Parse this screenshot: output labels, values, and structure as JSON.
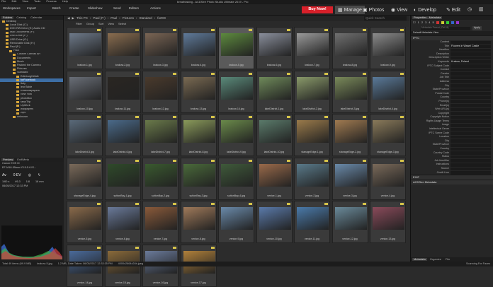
{
  "window": {
    "title": "breathtaking - ACDSee Photo Studio Ultimate 2019 - Pro"
  },
  "menu": [
    "File",
    "Edit",
    "View",
    "Tools",
    "Process",
    "Help"
  ],
  "toolbar": {
    "workspaces": "Workspaces",
    "import": "Import",
    "batch": "Batch",
    "create": "Create",
    "slideshow": "Slideshow",
    "send": "Send",
    "editors": "Editors",
    "actions": "Actions",
    "buy_now": "Buy Now!",
    "modes": {
      "manage": "Manage",
      "photos": "Photos",
      "view": "View",
      "develop": "Develop",
      "edit": "Edit"
    },
    "search_placeholder": "Quick Search"
  },
  "left_panel": {
    "tabs": [
      "Folders",
      "Catalog",
      "Calendar"
    ],
    "folders": [
      {
        "label": "Desktop",
        "level": 0,
        "selected": false
      },
      {
        "label": "Local Disk (C:)",
        "level": 1,
        "selected": false
      },
      {
        "label": "DVD RW Drive (E:) Audio CD",
        "level": 1,
        "selected": false
      },
      {
        "label": "Mac Documents (F:)",
        "level": 1,
        "selected": false
      },
      {
        "label": "USB Drive (F:)",
        "level": 1,
        "selected": false
      },
      {
        "label": "USB Drive (G:)",
        "level": 1,
        "selected": false
      },
      {
        "label": "Removable Disk (H:)",
        "level": 1,
        "selected": false
      },
      {
        "label": "Paul (F:)",
        "level": 1,
        "selected": false
      },
      {
        "label": "Paul",
        "level": 2,
        "selected": false
      },
      {
        "label": "Custom Canvas Art",
        "level": 3,
        "selected": false
      },
      {
        "label": "Documents",
        "level": 3,
        "selected": false
      },
      {
        "label": "Music",
        "level": 3,
        "selected": false
      },
      {
        "label": "Packed the Camera",
        "level": 3,
        "selected": false
      },
      {
        "label": "Pictures",
        "level": 3,
        "selected": false
      },
      {
        "label": "Standard",
        "level": 3,
        "selected": false
      },
      {
        "label": "EdinburghWalk",
        "level": 4,
        "selected": false
      },
      {
        "label": "forFacebook",
        "level": 4,
        "selected": true
      },
      {
        "label": "Italy",
        "level": 4,
        "selected": false
      },
      {
        "label": "leonTable",
        "level": 4,
        "selected": false
      },
      {
        "label": "KraftWallpapers",
        "level": 4,
        "selected": false
      },
      {
        "label": "New York",
        "level": 4,
        "selected": false
      },
      {
        "label": "photoBox",
        "level": 4,
        "selected": false
      },
      {
        "label": "rawsTrip",
        "level": 4,
        "selected": false
      },
      {
        "label": "UpWork",
        "level": 4,
        "selected": false
      },
      {
        "label": "wallpapers",
        "level": 4,
        "selected": false
      },
      {
        "label": "Zips",
        "level": 4,
        "selected": false
      },
      {
        "label": "unknown",
        "level": 3,
        "selected": false
      }
    ],
    "preview_tabs": [
      "Preview",
      "Exif/Meta"
    ],
    "camera": "Canon EOS M",
    "lens": "EF-M18-55mm f/3.5-5.6 IS...",
    "av": "Av",
    "ev": "0 EV",
    "iso": "1/60 s",
    "fstop": "f/6.3",
    "shutter": "1/8",
    "exposure": "18 mm",
    "date": "06/05/2017 12:33 PM"
  },
  "breadcrumb": [
    "This PC",
    "Paul (F:)",
    "Paul",
    "Pictures",
    "Standard",
    "forDD"
  ],
  "filterbar": [
    "Filter",
    "Group",
    "Sort",
    "View",
    "Select"
  ],
  "thumbnails": [
    {
      "name": "krakow-1.jpg",
      "color": "#6e7a8a"
    },
    {
      "name": "krakow-2.jpg",
      "color": "#8a6d4f"
    },
    {
      "name": "krakow-3.jpg",
      "color": "#7a6554"
    },
    {
      "name": "krakow-4.jpg",
      "color": "#5f7a9a"
    },
    {
      "name": "krakow-5.jpg",
      "color": "#5d8a3e",
      "selected": true
    },
    {
      "name": "krakow-6.jpg",
      "color": "#8a8f9c"
    },
    {
      "name": "krakow-7.jpg",
      "color": "#9a9a9a"
    },
    {
      "name": "krakow-8.jpg",
      "color": "#707070"
    },
    {
      "name": "krakow-9.jpg",
      "color": "#8b8b8b"
    },
    {
      "name": "krakow-10.jpg",
      "color": "#6a6f78"
    },
    {
      "name": "krakow-11.jpg",
      "color": "#2a2622"
    },
    {
      "name": "krakow-12.jpg",
      "color": "#4a3a2c"
    },
    {
      "name": "krakow-13.jpg",
      "color": "#7a6a52"
    },
    {
      "name": "krakow-14.jpg",
      "color": "#5a8a7a"
    },
    {
      "name": "lakeDistrict-1.jpg",
      "color": "#6f8a5a"
    },
    {
      "name": "lakeDistrict-2.jpg",
      "color": "#8a9a6a"
    },
    {
      "name": "lakeDistrict-3.jpg",
      "color": "#7a8a5a"
    },
    {
      "name": "lakeDistrict-4.jpg",
      "color": "#5a7a9a"
    },
    {
      "name": "lakeDistrict-5.jpg",
      "color": "#5a6a7a"
    },
    {
      "name": "lakeDistrict-6.jpg",
      "color": "#4a6a8a"
    },
    {
      "name": "lakeDistrict-7.jpg",
      "color": "#6a7a4a"
    },
    {
      "name": "lakeDistrict-8.jpg",
      "color": "#8a9a5a"
    },
    {
      "name": "lakeDistrict-9.jpg",
      "color": "#6a8a4a"
    },
    {
      "name": "lakeDistrict-10.jpg",
      "color": "#5a7a6a"
    },
    {
      "name": "stanageEdge-1.jpg",
      "color": "#9a7a4a"
    },
    {
      "name": "stanageEdge-2.jpg",
      "color": "#a07a50"
    },
    {
      "name": "stanageEdge-3.jpg",
      "color": "#8a7a5a"
    },
    {
      "name": "stanageEdge-4.jpg",
      "color": "#7a6a5a"
    },
    {
      "name": "suttonBay-1.jpg",
      "color": "#2f4a2a"
    },
    {
      "name": "suttonBay-2.jpg",
      "color": "#3a5a2f"
    },
    {
      "name": "suttonBay-3.jpg",
      "color": "#4a6a3a"
    },
    {
      "name": "suttonBay-4.jpg",
      "color": "#3f5a3a"
    },
    {
      "name": "venice-1.jpg",
      "color": "#9a6a4a"
    },
    {
      "name": "venice-2.jpg",
      "color": "#5a7a8a"
    },
    {
      "name": "venice-3.jpg",
      "color": "#6a8aaa"
    },
    {
      "name": "venice-4.jpg",
      "color": "#7a6a5a"
    },
    {
      "name": "venice-5.jpg",
      "color": "#8a6a4a"
    },
    {
      "name": "venice-6.jpg",
      "color": "#6a7a9a"
    },
    {
      "name": "venice-7.jpg",
      "color": "#8a5a3a"
    },
    {
      "name": "venice-8.jpg",
      "color": "#a07a5a"
    },
    {
      "name": "venice-9.jpg",
      "color": "#6a8aaa"
    },
    {
      "name": "venice-10.jpg",
      "color": "#5a7aaa"
    },
    {
      "name": "venice-11.jpg",
      "color": "#4a7aaa"
    },
    {
      "name": "venice-12.jpg",
      "color": "#6a8a9a"
    },
    {
      "name": "venice-13.jpg",
      "color": "#8a4a5a"
    },
    {
      "name": "venice-14.jpg",
      "color": "#4a6a9a"
    },
    {
      "name": "venice-15.jpg",
      "color": "#8a6a3a"
    },
    {
      "name": "venice-16.jpg",
      "color": "#6a7a9a"
    },
    {
      "name": "venice-17.jpg",
      "color": "#b0803a"
    }
  ],
  "right_panel": {
    "title": "Properties - Metadata",
    "preset_placeholder": "Metadata Preset (Ctrl-M)",
    "apply": "Apply",
    "view": "Default Metadata View",
    "iptc_title": "IPTC",
    "fields": [
      {
        "label": "Content",
        "value": ""
      },
      {
        "label": "Title",
        "value": "Flowers in Wawel Castle"
      },
      {
        "label": "Headline",
        "value": ""
      },
      {
        "label": "Description",
        "value": ""
      },
      {
        "label": "Description Writer",
        "value": ""
      },
      {
        "label": "Keywords",
        "value": "Krakow, Poland"
      },
      {
        "label": "IPTC Subject Code",
        "value": ""
      },
      {
        "label": "Contact",
        "value": ""
      },
      {
        "label": "Creator",
        "value": ""
      },
      {
        "label": "Job Title",
        "value": ""
      },
      {
        "label": "Address",
        "value": ""
      },
      {
        "label": "City",
        "value": ""
      },
      {
        "label": "State/Province",
        "value": ""
      },
      {
        "label": "Postal Code",
        "value": ""
      },
      {
        "label": "Country",
        "value": ""
      },
      {
        "label": "Phone(s)",
        "value": ""
      },
      {
        "label": "Email(s)",
        "value": ""
      },
      {
        "label": "Web URL(s)",
        "value": ""
      },
      {
        "label": "Copyright",
        "value": ""
      },
      {
        "label": "Copyright Notice",
        "value": ""
      },
      {
        "label": "Rights Usage Terms",
        "value": ""
      },
      {
        "label": "Image",
        "value": ""
      },
      {
        "label": "Intellectual Genre",
        "value": ""
      },
      {
        "label": "IPTC Scene Code",
        "value": ""
      },
      {
        "label": "Location",
        "value": ""
      },
      {
        "label": "City",
        "value": ""
      },
      {
        "label": "State/Province",
        "value": ""
      },
      {
        "label": "Country",
        "value": ""
      },
      {
        "label": "Country Code",
        "value": ""
      },
      {
        "label": "Status",
        "value": ""
      },
      {
        "label": "Job Identifier",
        "value": ""
      },
      {
        "label": "Instructions",
        "value": ""
      },
      {
        "label": "Source",
        "value": ""
      },
      {
        "label": "Credit Line",
        "value": ""
      }
    ],
    "exif": "EXIF",
    "acdsee_meta": "ACDSee Metadata",
    "bottom_tabs": [
      "Metadata",
      "Organize",
      "File"
    ]
  },
  "status": {
    "total": "Total 49 items (99.9 MB)",
    "selected": "krakow-5.jpg",
    "info": "1.2 MB, Date Taken: 06/05/2017 12:33:35 PM",
    "dims": "4000x2664x24b jpeg",
    "right": "Scanning For Faces"
  }
}
